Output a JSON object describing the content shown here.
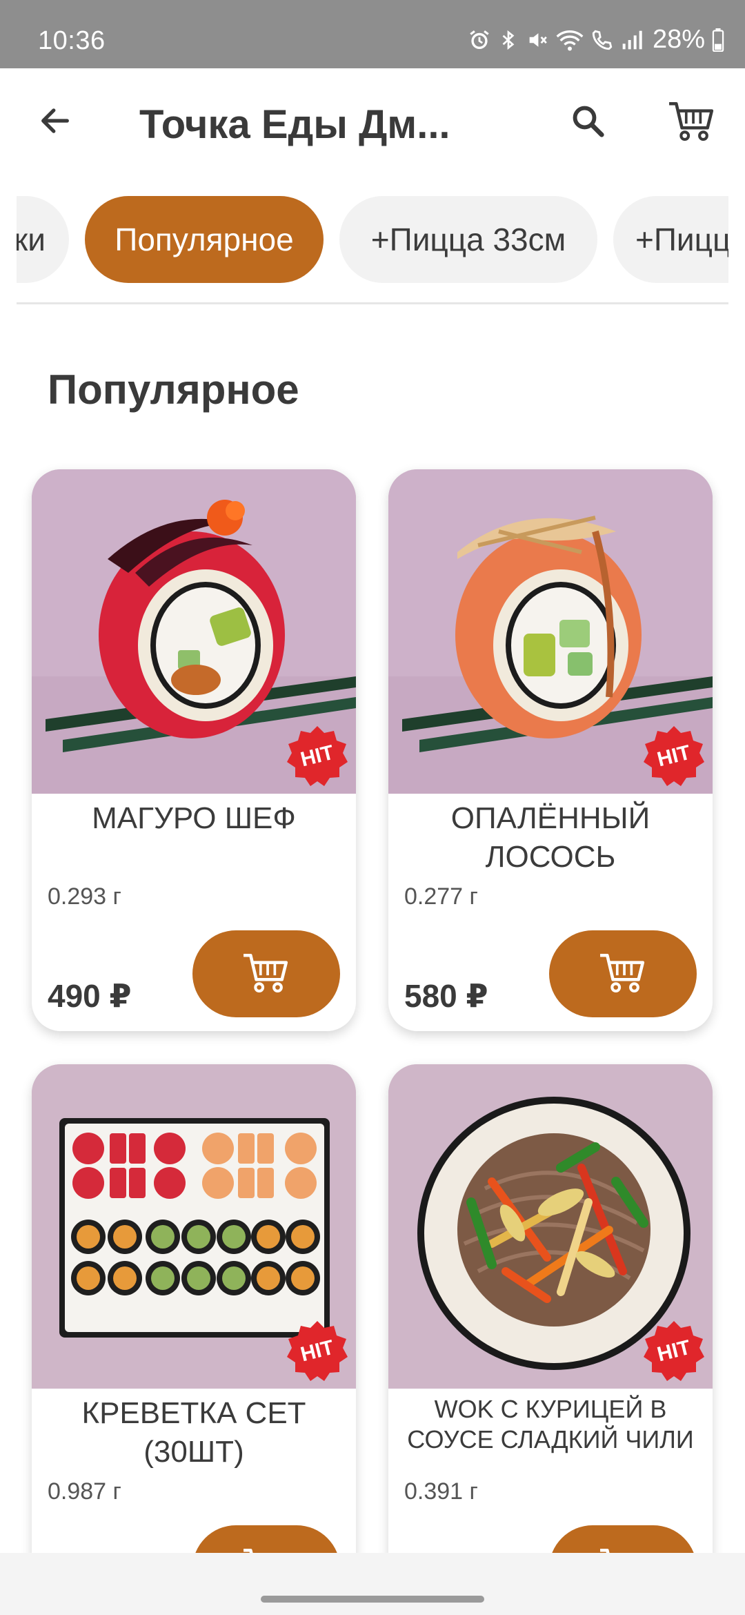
{
  "status_bar": {
    "time": "10:36",
    "battery": "28%"
  },
  "app_bar": {
    "title": "Точка Еды Дм..."
  },
  "tabs": [
    {
      "label": "ки"
    },
    {
      "label": "Популярное"
    },
    {
      "label": "+Пицца 33см"
    },
    {
      "label": "+Пицц"
    }
  ],
  "active_tab_index": 1,
  "section": {
    "title": "Популярное"
  },
  "products": [
    {
      "name": "МАГУРО ШЕФ",
      "weight": "0.293 г",
      "price": "490 ₽",
      "badge": "HIT"
    },
    {
      "name": "ОПАЛЁННЫЙ ЛОСОСЬ",
      "weight": "0.277 г",
      "price": "580 ₽",
      "badge": "HIT"
    },
    {
      "name": "КРЕВЕТКА СЕТ (30шт)",
      "weight": "0.987 г",
      "price": "",
      "badge": "HIT"
    },
    {
      "name": "WOK С КУРИЦЕЙ В СОУСЕ СЛАДКИЙ ЧИЛИ",
      "weight": "0.391 г",
      "price": "",
      "badge": "HIT"
    }
  ],
  "colors": {
    "accent": "#bd6a1e",
    "badge": "#e0262b",
    "image_bg": "#cdb4c6"
  },
  "icons": [
    "arrow-back-icon",
    "search-icon",
    "cart-icon",
    "alarm-icon",
    "bluetooth-icon",
    "mute-icon",
    "wifi-icon",
    "call-icon",
    "signal-icon",
    "battery-icon"
  ]
}
